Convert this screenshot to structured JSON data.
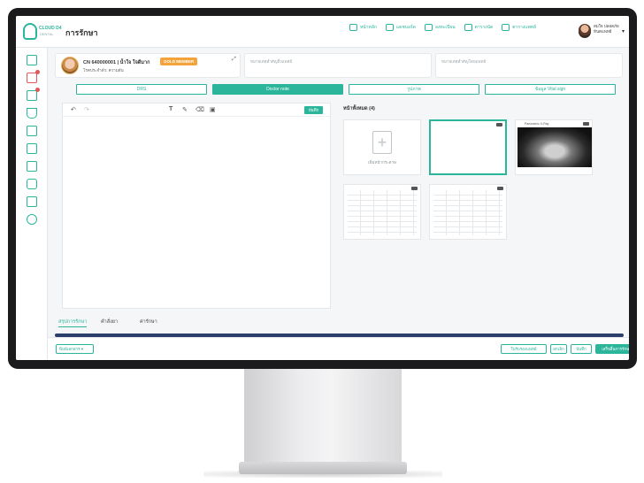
{
  "app": {
    "brand": "CLOUD D4",
    "brand_sub": "DENTAL",
    "page_title": "การรักษา"
  },
  "nav": [
    {
      "label": "หน้าหลัก",
      "icon": "home-icon"
    },
    {
      "label": "แดชบอร์ด",
      "icon": "chart-icon"
    },
    {
      "label": "ลงทะเบียน",
      "icon": "id-card-icon"
    },
    {
      "label": "ตารางนัด",
      "icon": "calendar-user-icon"
    },
    {
      "label": "ตารางแพทย์",
      "icon": "doctor-icon"
    }
  ],
  "user": {
    "name_line1": "สมใจ ปลอดภัย",
    "name_line2": "ทันตแพทย์"
  },
  "patient": {
    "name": "CN 640000001 | น้ำใจ ใจดีมาก",
    "badge": "GOLD MEMBER",
    "sub": "โรคประจำตัว: ความดัน"
  },
  "notes": {
    "important_note": "หมายเหตุสำคัญถึงแพทย์",
    "doctor_note": "หมายเหตุสำคัญโดยแพทย์"
  },
  "tabs": [
    {
      "label": "DRS",
      "active": false
    },
    {
      "label": "Doctor note",
      "active": true
    },
    {
      "label": "รูปภาพ",
      "active": false
    },
    {
      "label": "ข้อมูล Vital sign",
      "active": false
    }
  ],
  "editor": {
    "save_label": "บันทึก"
  },
  "images": {
    "title": "หน้าทั้งหมด (4)",
    "add_label": "เพิ่มหน้ากระดาษ",
    "xray_caption": "Panoramic X-Ray"
  },
  "bottom_tabs": [
    {
      "label": "สรุปการรักษา",
      "active": true
    },
    {
      "label": "คำสั่งยา",
      "active": false
    },
    {
      "label": "ค่ารักษา",
      "active": false
    }
  ],
  "footer": {
    "print_select": "พิมพ์เอกสาร",
    "btn_certificate": "ใบรับรองแพทย์",
    "btn_cancel": "ยกเลิก",
    "btn_save": "บันทึก",
    "btn_finish": "เสร็จสิ้นการรักษา"
  },
  "colors": {
    "accent": "#2bb59a",
    "badge": "#f2a33a",
    "navy": "#2c3e6b"
  }
}
